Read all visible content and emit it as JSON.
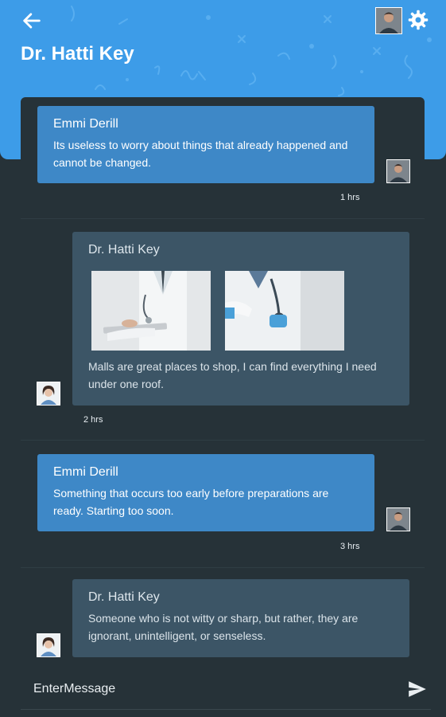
{
  "header": {
    "title": "Dr. Hatti Key",
    "back_icon": "arrow-left-icon",
    "settings_icon": "gear-icon",
    "color": "#3d9ce8"
  },
  "messages": [
    {
      "sender": "Emmi Derill",
      "text": "Its useless to worry about things that already happened and cannot be changed.",
      "time": "1 hrs",
      "direction": "outgoing"
    },
    {
      "sender": "Dr. Hatti Key",
      "attachments": [
        "doctor-with-tablet-photo",
        "doctor-with-stethoscope-photo"
      ],
      "text": "Malls are great places to shop, I can find everything I need under one roof.",
      "time": "2 hrs",
      "direction": "incoming"
    },
    {
      "sender": "Emmi Derill",
      "text": "Something that occurs too early before preparations are ready. Starting too soon.",
      "time": "3 hrs",
      "direction": "outgoing"
    },
    {
      "sender": "Dr. Hatti Key",
      "text": "Someone who is not witty or sharp, but rather, they are ignorant, unintelligent, or senseless.",
      "direction": "incoming"
    }
  ],
  "composer": {
    "placeholder": "EnterMessage",
    "send_icon": "send-icon"
  },
  "colors": {
    "background": "#263238",
    "outgoing_bubble": "#3e88c7",
    "incoming_bubble": "#3c5566"
  }
}
